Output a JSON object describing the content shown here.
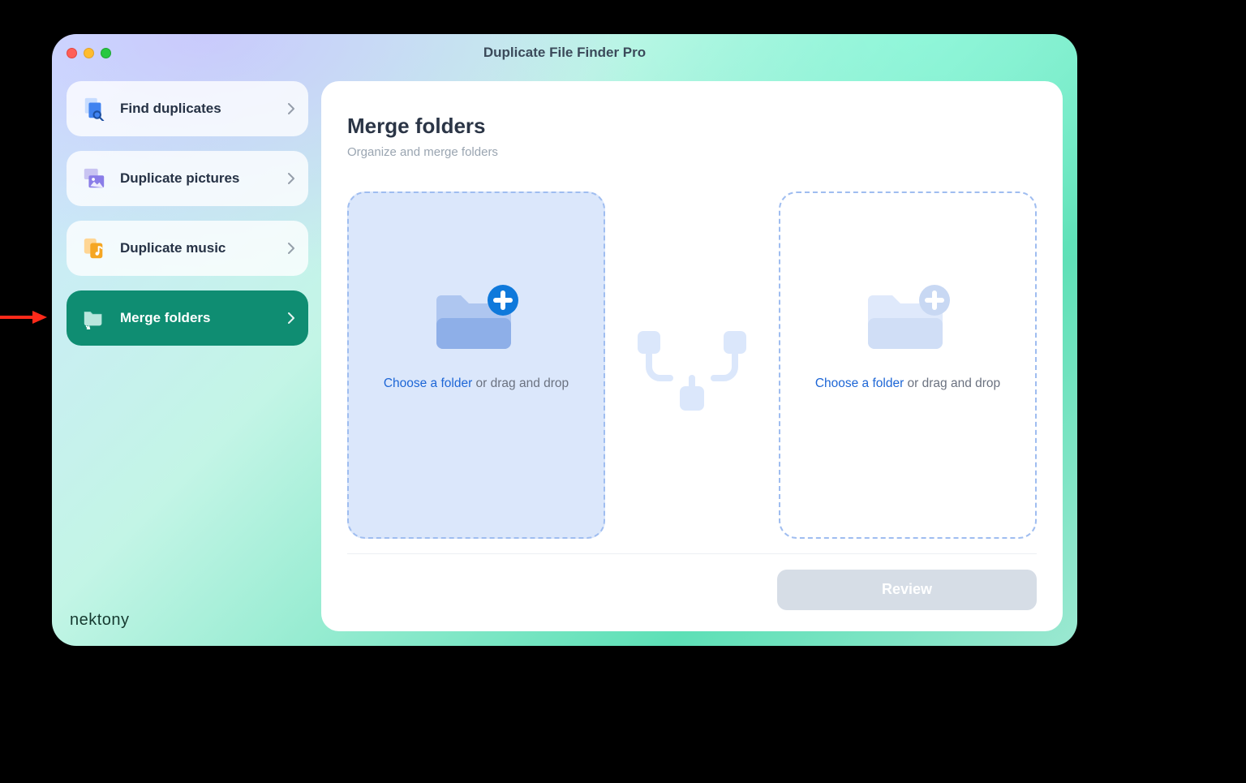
{
  "window": {
    "title": "Duplicate File Finder Pro"
  },
  "sidebar": {
    "items": [
      {
        "label": "Find duplicates"
      },
      {
        "label": "Duplicate pictures"
      },
      {
        "label": "Duplicate music"
      },
      {
        "label": "Merge folders"
      }
    ]
  },
  "content": {
    "heading": "Merge folders",
    "subheading": "Organize and merge folders",
    "drop_link": "Choose a folder",
    "drop_rest": " or drag and drop"
  },
  "footer": {
    "review_label": "Review"
  },
  "branding": {
    "logo": "nektony"
  }
}
